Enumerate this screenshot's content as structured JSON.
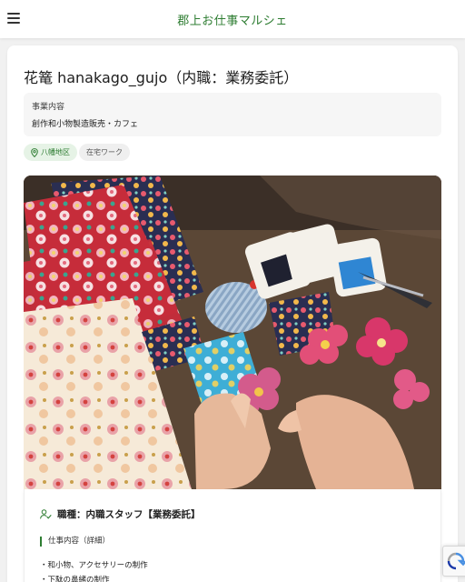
{
  "header": {
    "site_title": "郡上お仕事マルシェ",
    "menu_icon": "hamburger-menu-icon"
  },
  "listing": {
    "title": "花篭 hanakago_gujo（内職：業務委託）",
    "business": {
      "label": "事業内容",
      "value": "創作和小物製造販売・カフェ"
    },
    "tags": {
      "area": "八幡地区",
      "work_style": "在宅ワーク"
    },
    "job": {
      "type_label": "職種：内職スタッフ【業務委託】",
      "section_heading": "仕事内容（詳細）",
      "details": [
        "・和小物、アクセサリーの制作",
        "・下駄の鼻緒の制作"
      ]
    }
  },
  "colors": {
    "brand_green": "#2e7d32",
    "tag_green_bg": "#e6f3e6",
    "page_bg": "#f1f1f1"
  }
}
